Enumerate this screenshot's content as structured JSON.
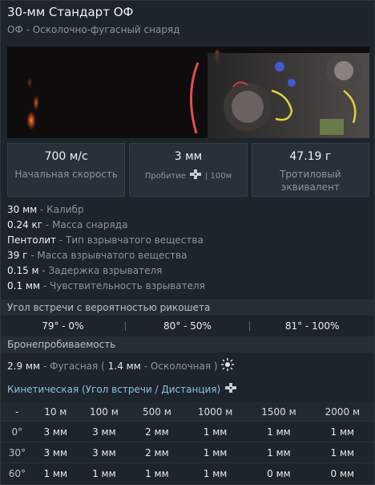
{
  "header": {
    "title": "30-мм Стандарт ОФ",
    "subtitle": "ОФ - Осколочно-фугасный снаряд"
  },
  "stats": [
    {
      "value": "700 м/с",
      "label": "Начальная скорость"
    },
    {
      "value": "3 мм",
      "label_prefix": "Пробитие",
      "label_suffix": "| 100м"
    },
    {
      "value": "47.19 г",
      "label": "Тротиловый эквивалент"
    }
  ],
  "properties": [
    {
      "value": "30 мм",
      "desc": "- Калибр"
    },
    {
      "value": "0.24 кг",
      "desc": "- Масса снаряда"
    },
    {
      "value": "Пентолит",
      "desc": "- Тип взрывчатого вещества"
    },
    {
      "value": "39 г",
      "desc": "- Масса взрывчатого вещества"
    },
    {
      "value": "0.15 м",
      "desc": "- Задержка взрывателя"
    },
    {
      "value": "0.1 мм",
      "desc": "- Чувствительность взрывателя"
    }
  ],
  "ricochet": {
    "title": "Угол встречи с вероятностью рикошета",
    "values": [
      "79° - 0%",
      "80° - 50%",
      "81° - 100%"
    ]
  },
  "penetration": {
    "title": "Бронепробиваемость",
    "he_value": "2.9 мм",
    "he_label": "- Фугасная (",
    "frag_value": "1.4 мм",
    "frag_label": "- Осколочная )"
  },
  "kinetic": {
    "title": "Кинетическая (Угол встречи / Дистанция)",
    "columns": [
      "-",
      "10 м",
      "100 м",
      "500 м",
      "1000 м",
      "1500 м",
      "2000 м"
    ],
    "rows": [
      {
        "angle": "0°",
        "values": [
          "3 мм",
          "3 мм",
          "2 мм",
          "1 мм",
          "1 мм",
          "1 мм"
        ]
      },
      {
        "angle": "30°",
        "values": [
          "3 мм",
          "3 мм",
          "2 мм",
          "1 мм",
          "1 мм",
          "1 мм"
        ]
      },
      {
        "angle": "60°",
        "values": [
          "1 мм",
          "1 мм",
          "1 мм",
          "1 мм",
          "0 мм",
          "0 мм"
        ]
      }
    ]
  },
  "icons": {
    "target": "target-crosshair-icon",
    "blast": "explosion-icon"
  },
  "colors": {
    "accent": "#8cc4e0",
    "background": "#1d242b",
    "muted": "#8c969e"
  }
}
